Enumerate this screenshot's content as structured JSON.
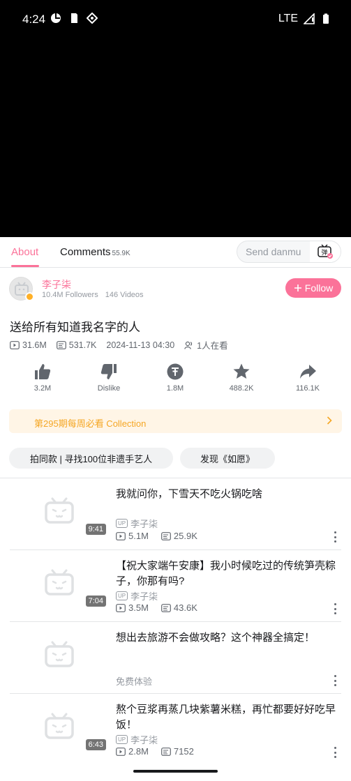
{
  "status_bar": {
    "time": "4:24",
    "network": "LTE"
  },
  "tabs": {
    "about": "About",
    "comments": "Comments",
    "comments_count": "55.9K",
    "danmu_placeholder": "Send danmu",
    "danmu_button": "弹"
  },
  "uploader": {
    "name": "李子柒",
    "followers": "10.4M Followers",
    "videos": "146 Videos",
    "follow_label": "Follow"
  },
  "video": {
    "title": "送给所有知道我名字的人",
    "views": "31.6M",
    "danmaku": "531.7K",
    "date": "2024-11-13 04:30",
    "watching": "1人在看"
  },
  "actions": {
    "like": "3.2M",
    "dislike": "Dislike",
    "coin": "1.8M",
    "favorite": "488.2K",
    "share": "116.1K"
  },
  "collection": {
    "label": "第295期每周必看 Collection"
  },
  "tags": [
    "拍同款 | 寻找100位非遗手艺人",
    "发现《如愿》"
  ],
  "recommendations": [
    {
      "title": "我就问你，下雪天不吃火锅吃啥",
      "duration": "9:41",
      "up": "李子柒",
      "views": "5.1M",
      "danmaku": "25.9K"
    },
    {
      "title": "【祝大家端午安康】我小时候吃过的传统笋壳粽子，你那有吗?",
      "duration": "7:04",
      "up": "李子柒",
      "views": "3.5M",
      "danmaku": "43.6K"
    },
    {
      "title": "想出去旅游不会做攻略？这个神器全搞定！",
      "ad_label": "免费体验"
    },
    {
      "title": "熬个豆浆再蒸几块紫薯米糕，再忙都要好好吃早饭！",
      "duration": "6:43",
      "up": "李子柒",
      "views": "2.8M",
      "danmaku": "7152"
    }
  ],
  "colors": {
    "accent": "#fb7299",
    "collection_text": "#f5a623",
    "collection_bg": "#fff5e6"
  }
}
